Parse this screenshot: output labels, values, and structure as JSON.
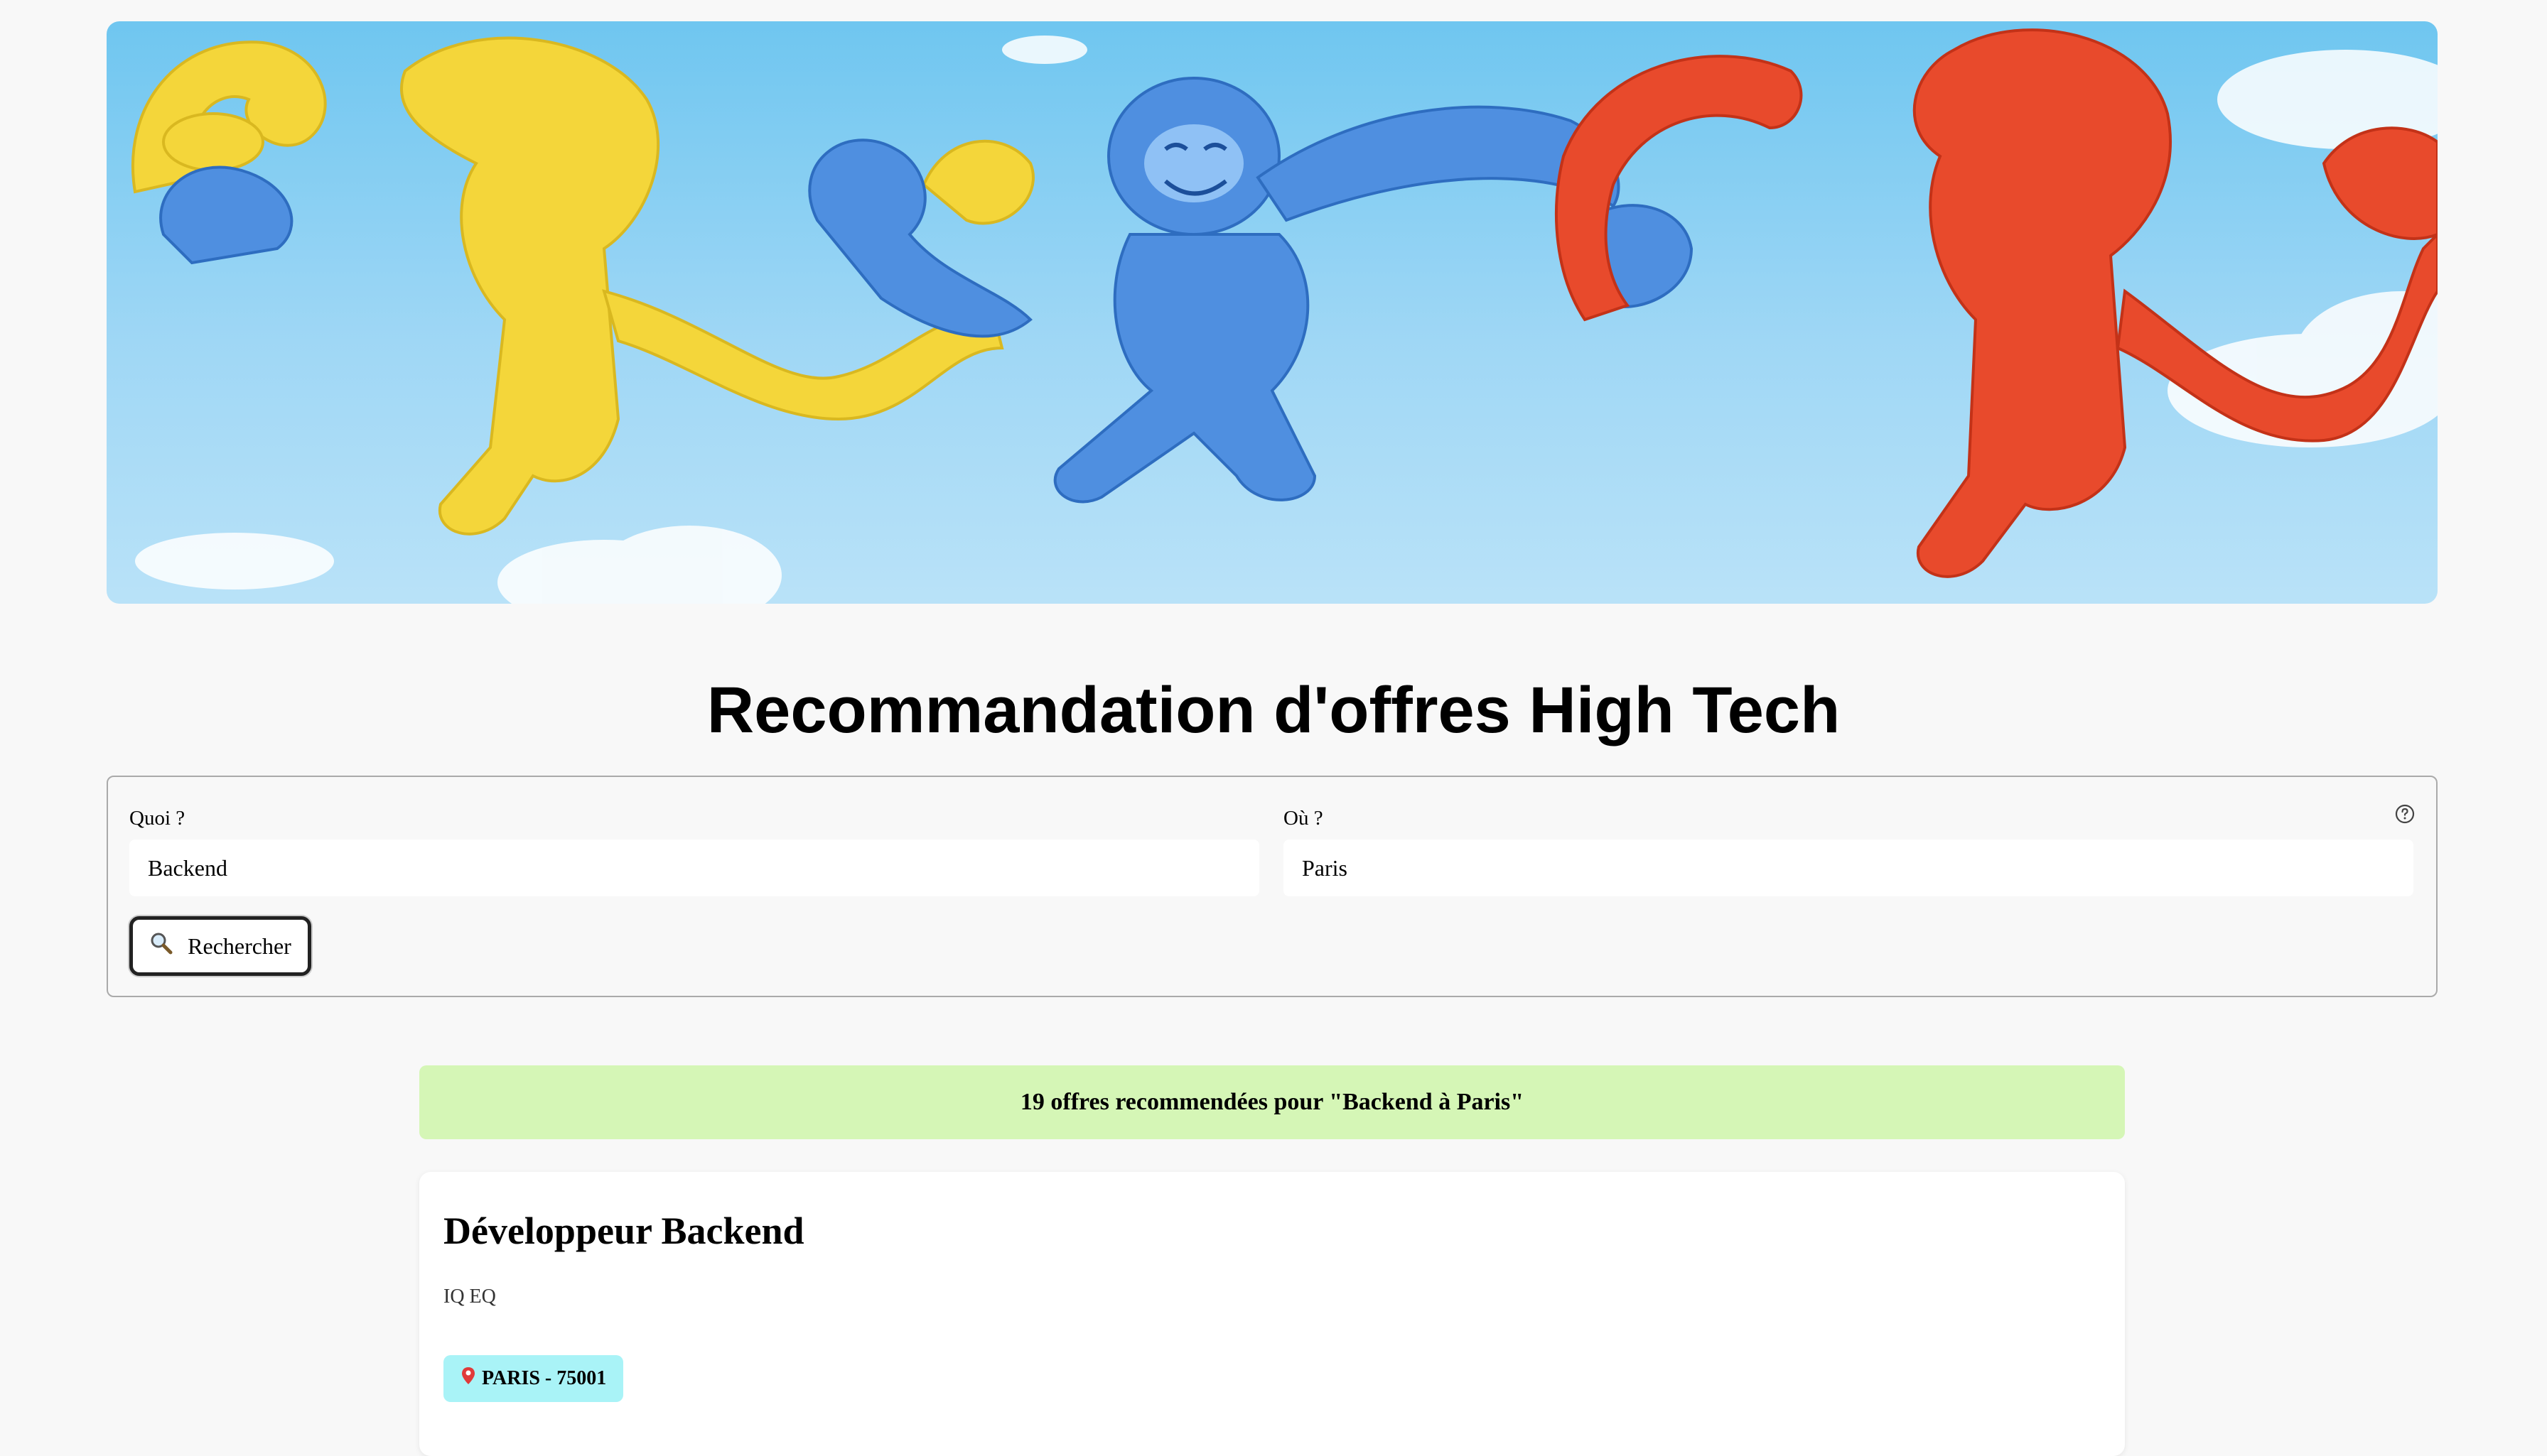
{
  "banner": {
    "alt": "Singes en plastique colorés"
  },
  "title": "Recommandation d'offres High Tech",
  "search": {
    "what_label": "Quoi ?",
    "what_value": "Backend",
    "where_label": "Où ?",
    "where_value": "Paris",
    "button_label": "Rechercher",
    "button_icon": "magnifier-icon",
    "help_icon": "help-circle-icon"
  },
  "results": {
    "summary": "19 offres recommendées pour \"Backend à Paris\"",
    "jobs": [
      {
        "title": "Développeur Backend",
        "company": "IQ EQ",
        "location": "PARIS - 75001",
        "location_icon": "pin-icon"
      }
    ]
  },
  "colors": {
    "background": "#f8f8f8",
    "summary_bg": "#d5f6b6",
    "location_badge_bg": "#a9f3f7",
    "monkey_yellow": "#f4d63a",
    "monkey_blue": "#4f8fe0",
    "monkey_red": "#e84a2c"
  }
}
